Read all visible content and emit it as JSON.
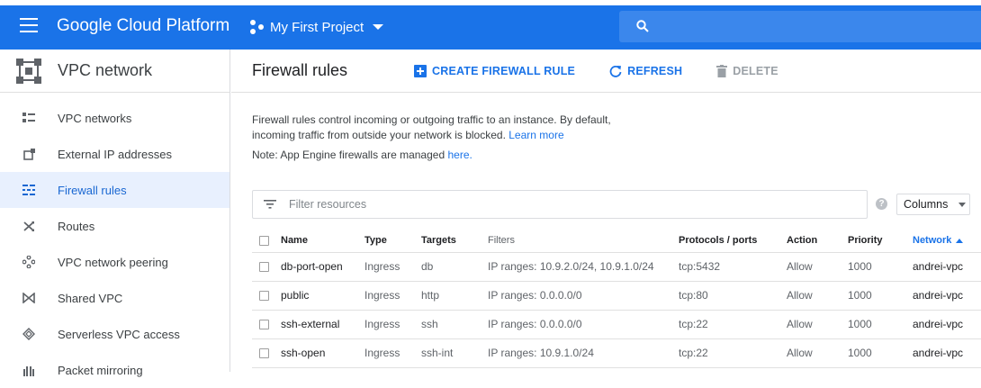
{
  "topbar": {
    "brand": "Google Cloud Platform",
    "project": "My First Project",
    "search_placeholder": ""
  },
  "sidebar": {
    "title": "VPC network",
    "items": [
      {
        "label": "VPC networks",
        "icon": "vpc-networks-icon"
      },
      {
        "label": "External IP addresses",
        "icon": "external-ip-icon"
      },
      {
        "label": "Firewall rules",
        "icon": "firewall-icon",
        "active": true
      },
      {
        "label": "Routes",
        "icon": "routes-icon"
      },
      {
        "label": "VPC network peering",
        "icon": "peering-icon"
      },
      {
        "label": "Shared VPC",
        "icon": "shared-vpc-icon"
      },
      {
        "label": "Serverless VPC access",
        "icon": "serverless-icon"
      },
      {
        "label": "Packet mirroring",
        "icon": "packet-mirroring-icon"
      }
    ]
  },
  "main": {
    "title": "Firewall rules",
    "create_label": "CREATE FIREWALL RULE",
    "refresh_label": "REFRESH",
    "delete_label": "DELETE",
    "desc_line1": "Firewall rules control incoming or outgoing traffic to an instance. By default,",
    "desc_line2": "incoming traffic from outside your network is blocked.",
    "learn_more": "Learn more",
    "note_prefix": "Note: App Engine firewalls are managed",
    "note_link": "here.",
    "filter_placeholder": "Filter resources",
    "columns_label": "Columns",
    "help": "?"
  },
  "table": {
    "headers": [
      "Name",
      "Type",
      "Targets",
      "Filters",
      "Protocols / ports",
      "Action",
      "Priority",
      "Network"
    ],
    "rows": [
      {
        "name": "db-port-open",
        "type": "Ingress",
        "targets": "db",
        "filters": "IP ranges: 10.9.2.0/24, 10.9.1.0/24",
        "ports": "tcp:5432",
        "action": "Allow",
        "priority": "1000",
        "network": "andrei-vpc"
      },
      {
        "name": "public",
        "type": "Ingress",
        "targets": "http",
        "filters": "IP ranges: 0.0.0.0/0",
        "ports": "tcp:80",
        "action": "Allow",
        "priority": "1000",
        "network": "andrei-vpc"
      },
      {
        "name": "ssh-external",
        "type": "Ingress",
        "targets": "ssh",
        "filters": "IP ranges: 0.0.0.0/0",
        "ports": "tcp:22",
        "action": "Allow",
        "priority": "1000",
        "network": "andrei-vpc"
      },
      {
        "name": "ssh-open",
        "type": "Ingress",
        "targets": "ssh-int",
        "filters": "IP ranges: 10.9.1.0/24",
        "ports": "tcp:22",
        "action": "Allow",
        "priority": "1000",
        "network": "andrei-vpc"
      }
    ]
  },
  "colors": {
    "brand": "#1a73e8",
    "active_bg": "#e8f0fe"
  }
}
